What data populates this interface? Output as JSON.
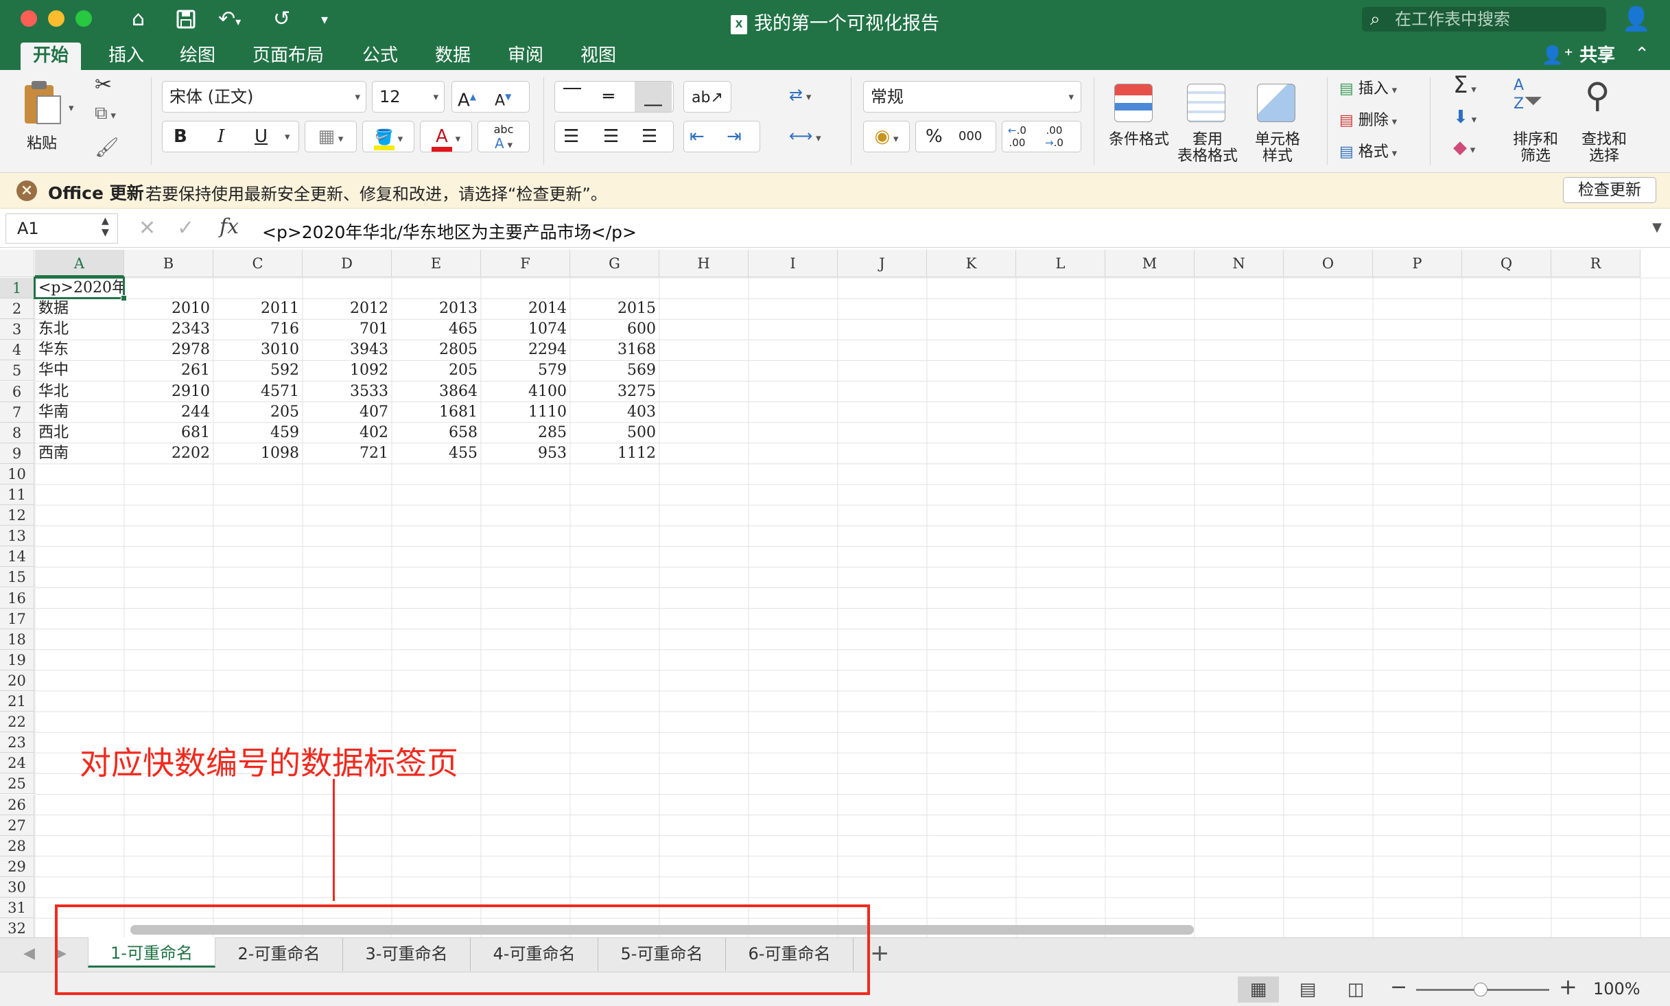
{
  "window": {
    "title": "我的第一个可视化报告",
    "search_placeholder": "在工作表中搜索"
  },
  "ribbon_tabs": [
    "开始",
    "插入",
    "绘图",
    "页面布局",
    "公式",
    "数据",
    "审阅",
    "视图"
  ],
  "share_label": "共享",
  "ribbon": {
    "paste_label": "粘贴",
    "font_name": "宋体 (正文)",
    "font_size": "12",
    "bold": "B",
    "italic": "I",
    "underline": "U",
    "font_color_letter": "A",
    "number_format": "常规",
    "percent": "%",
    "thousands": "000",
    "increase_decimal": ".00",
    "decrease_decimal": ".0",
    "wrap_text": "abc",
    "cond_format_label": "条件格式",
    "table_format_label": "套用\n表格格式",
    "cell_style_label": "单元格\n样式",
    "insert_label": "插入",
    "delete_label": "删除",
    "format_label": "格式",
    "sort_label": "排序和\n筛选",
    "find_label": "查找和\n选择"
  },
  "notice": {
    "title": "Office 更新",
    "message": "若要保持使用最新安全更新、修复和改进，请选择“检查更新”。",
    "button": "检查更新"
  },
  "formula_bar": {
    "name_box": "A1",
    "formula": "<p>2020年华北/华东地区为主要产品市场</p>"
  },
  "columns": [
    "A",
    "B",
    "C",
    "D",
    "E",
    "F",
    "G",
    "H",
    "I",
    "J",
    "K",
    "L",
    "M",
    "N",
    "O",
    "P",
    "Q",
    "R"
  ],
  "row_count": 32,
  "cells": {
    "a1_display": "<p>2020年华",
    "rows": [
      [
        "数据",
        "2010",
        "2011",
        "2012",
        "2013",
        "2014",
        "2015"
      ],
      [
        "东北",
        "2343",
        "716",
        "701",
        "465",
        "1074",
        "600"
      ],
      [
        "华东",
        "2978",
        "3010",
        "3943",
        "2805",
        "2294",
        "3168"
      ],
      [
        "华中",
        "261",
        "592",
        "1092",
        "205",
        "579",
        "569"
      ],
      [
        "华北",
        "2910",
        "4571",
        "3533",
        "3864",
        "4100",
        "3275"
      ],
      [
        "华南",
        "244",
        "205",
        "407",
        "1681",
        "1110",
        "403"
      ],
      [
        "西北",
        "681",
        "459",
        "402",
        "658",
        "285",
        "500"
      ],
      [
        "西南",
        "2202",
        "1098",
        "721",
        "455",
        "953",
        "1112"
      ]
    ]
  },
  "sheet_tabs": [
    "1-可重命名",
    "2-可重命名",
    "3-可重命名",
    "4-可重命名",
    "5-可重命名",
    "6-可重命名"
  ],
  "add_sheet": "+",
  "status": {
    "zoom": "100%"
  },
  "annotation": {
    "text": "对应快数编号的数据标签页",
    "color": "#f02a1e"
  },
  "colors": {
    "accent": "#217346",
    "notice_bg": "#fcf3dc"
  }
}
